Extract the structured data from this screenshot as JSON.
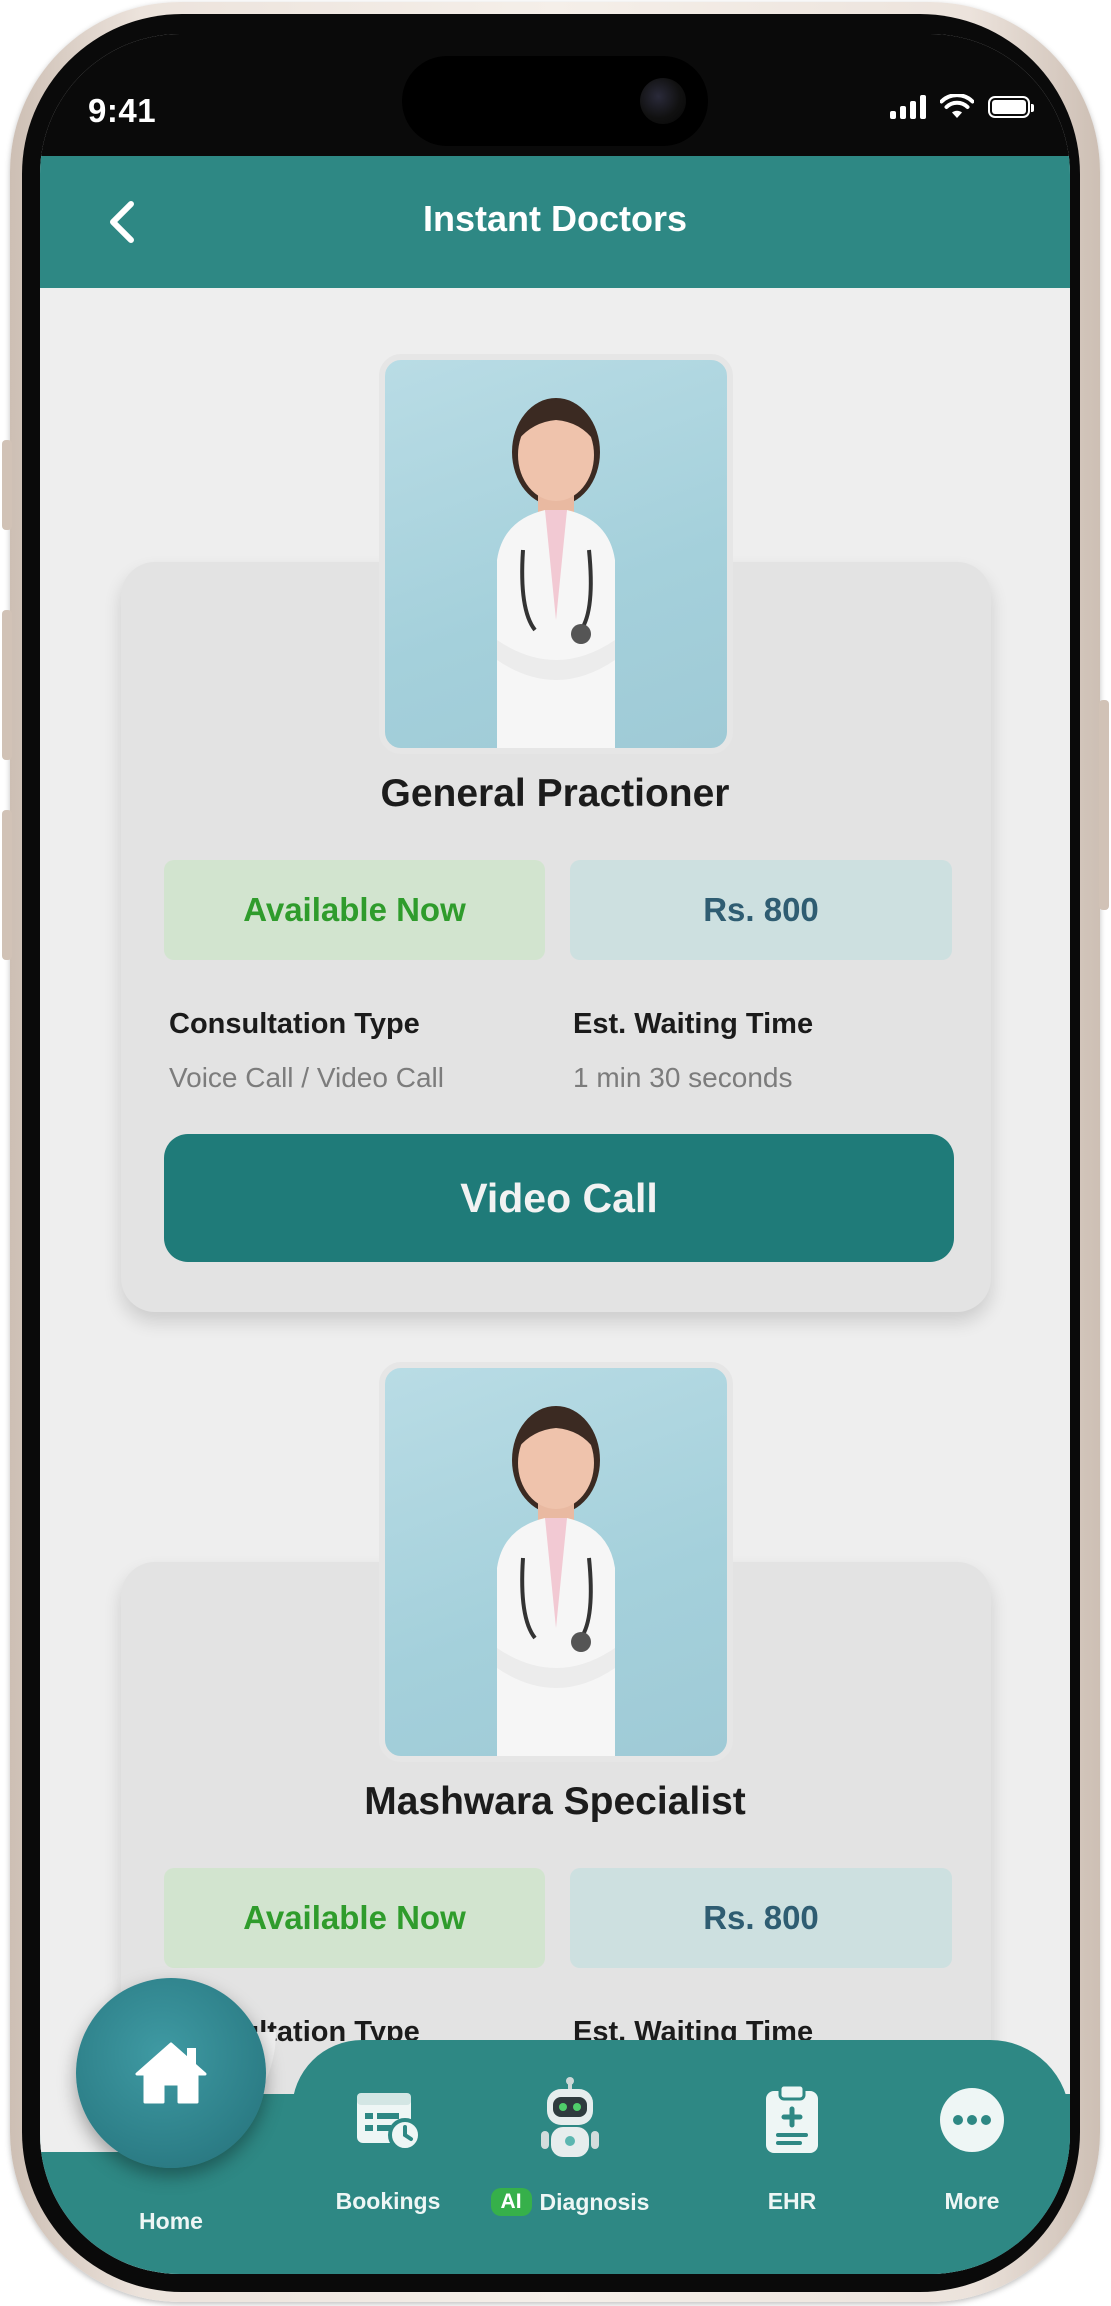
{
  "status_bar": {
    "time": "9:41"
  },
  "header": {
    "title": "Instant Doctors"
  },
  "doctors": [
    {
      "specialty": "General Practioner",
      "availability": "Available Now",
      "price": "Rs. 800",
      "consultation_label": "Consultation Type",
      "consultation_value": "Voice Call / Video Call",
      "waiting_label": "Est. Waiting Time",
      "waiting_value": "1 min 30 seconds",
      "action_label": "Video Call"
    },
    {
      "specialty": "Mashwara Specialist",
      "availability": "Available Now",
      "price": "Rs. 800",
      "consultation_label": "Consultation Type",
      "waiting_label": "Est. Waiting Time"
    }
  ],
  "bottom_nav": {
    "items": [
      {
        "label": "Home",
        "icon": "home-icon"
      },
      {
        "label": "Bookings",
        "icon": "bookings-icon"
      },
      {
        "badge": "AI",
        "label": "Diagnosis",
        "icon": "robot-icon"
      },
      {
        "label": "EHR",
        "icon": "clipboard-icon"
      },
      {
        "label": "More",
        "icon": "more-icon"
      }
    ],
    "active": "Home"
  },
  "colors": {
    "primary": "#2e8884",
    "button": "#1f7b79",
    "available_text": "#2f9c2c",
    "available_bg": "#d2e4cf",
    "price_text": "#2f5d72",
    "price_bg": "#cde0e0"
  }
}
